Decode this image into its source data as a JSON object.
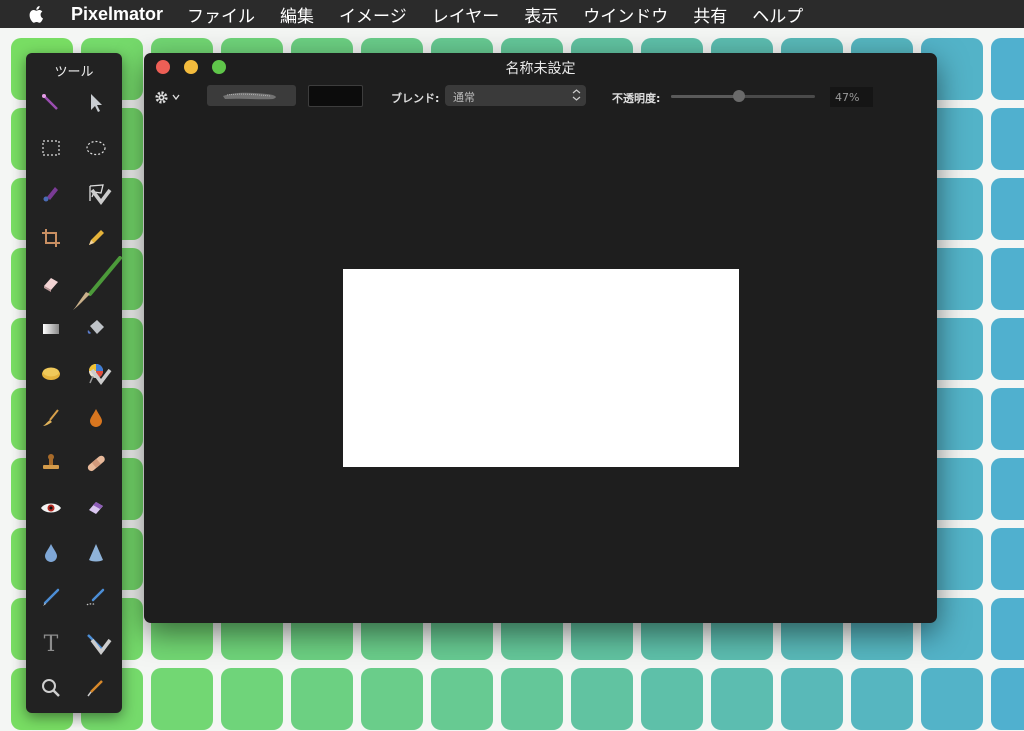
{
  "menubar": {
    "app_name": "Pixelmator",
    "items": [
      "ファイル",
      "編集",
      "イメージ",
      "レイヤー",
      "表示",
      "ウインドウ",
      "共有",
      "ヘルプ"
    ]
  },
  "tools_palette": {
    "title": "ツール",
    "tools": [
      {
        "name": "magic-wand-icon"
      },
      {
        "name": "move-arrow-icon"
      },
      {
        "name": "rect-select-icon"
      },
      {
        "name": "ellipse-select-icon"
      },
      {
        "name": "color-picker-icon"
      },
      {
        "name": "lasso-icon"
      },
      {
        "name": "crop-icon"
      },
      {
        "name": "pencil-icon"
      },
      {
        "name": "eraser-icon"
      },
      {
        "name": "brush-icon"
      },
      {
        "name": "gradient-icon"
      },
      {
        "name": "paint-bucket-icon"
      },
      {
        "name": "sponge-icon"
      },
      {
        "name": "color-swatch-icon"
      },
      {
        "name": "smudge-icon"
      },
      {
        "name": "burn-drop-icon"
      },
      {
        "name": "clone-stamp-icon"
      },
      {
        "name": "bandage-icon"
      },
      {
        "name": "red-eye-icon"
      },
      {
        "name": "shape-eraser-icon"
      },
      {
        "name": "blur-drop-icon"
      },
      {
        "name": "sharpen-cone-icon"
      },
      {
        "name": "pen-icon"
      },
      {
        "name": "freeform-pen-icon"
      },
      {
        "name": "type-icon"
      },
      {
        "name": "line-icon"
      },
      {
        "name": "zoom-icon"
      },
      {
        "name": "eyedropper-icon"
      }
    ]
  },
  "document": {
    "title": "名称未設定",
    "toolbar": {
      "blend_label": "ブレンド:",
      "blend_value": "通常",
      "opacity_label": "不透明度:",
      "opacity_value": "47%",
      "opacity": 0.47,
      "color_well": "#0c0c0c"
    },
    "canvas_color": "#ffffff"
  },
  "colors": {
    "close": "#ed5f56",
    "minimize": "#f3bb3d",
    "zoom": "#5fc64a",
    "wallpaper_left": "#78de62",
    "wallpaper_right": "#4faed3"
  }
}
